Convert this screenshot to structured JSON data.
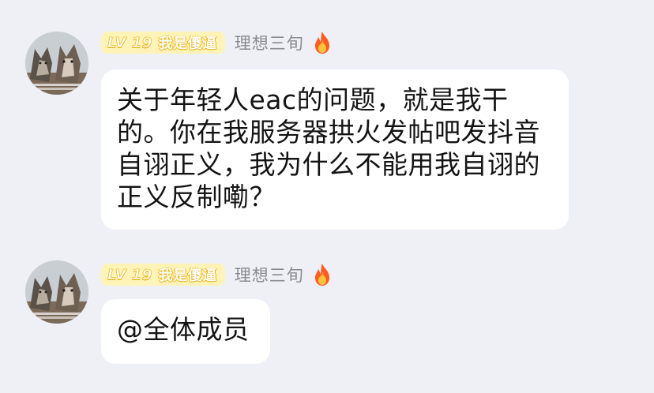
{
  "messages": [
    {
      "level": "LV 19",
      "title": "我是傻逼",
      "username": "理想三旬",
      "flair_icon": "fire-icon",
      "avatar": "wolf-avatar",
      "lines": [
        "关于年轻人eac的问题，就是我干",
        "的。你在我服务器拱火发帖吧发抖音",
        "自诩正义，我为什么不能用我自诩的",
        "正义反制嘞？"
      ]
    },
    {
      "level": "LV 19",
      "title": "我是傻逼",
      "username": "理想三旬",
      "flair_icon": "fire-icon",
      "avatar": "wolf-avatar",
      "lines": [
        "@全体成员"
      ]
    }
  ],
  "colors": {
    "background": "#efeff6",
    "bubble": "#ffffff",
    "badge_bg": "#fff3b8",
    "badge_text_outline": "#f0b300",
    "username": "#8a8a91"
  }
}
